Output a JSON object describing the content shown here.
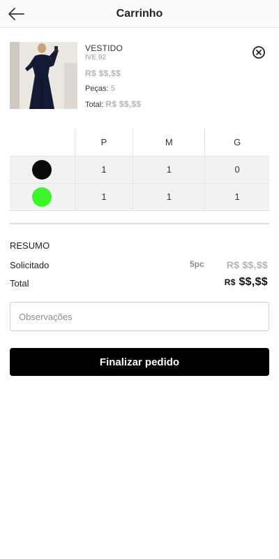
{
  "header": {
    "title": "Carrinho"
  },
  "product": {
    "name": "VESTIDO",
    "code": "IVE 92",
    "price": "R$ $$,$$",
    "pieces_label": "Peças:",
    "pieces_value": "5",
    "total_label": "Total:",
    "total_value": "R$ $$,$$"
  },
  "grid": {
    "sizes": [
      "P",
      "M",
      "G"
    ],
    "rows": [
      {
        "color": "#0a0a0a",
        "qty": [
          "1",
          "1",
          "0"
        ]
      },
      {
        "color": "#3cf52a",
        "qty": [
          "1",
          "1",
          "1"
        ]
      }
    ]
  },
  "summary": {
    "title": "RESUMO",
    "requested_label": "Solicitado",
    "requested_qty": "5pc",
    "requested_value": "R$ $$,$$",
    "total_label": "Total",
    "total_currency": "R$",
    "total_amount": "$$,$$"
  },
  "observations": {
    "placeholder": "Observações",
    "value": ""
  },
  "actions": {
    "finalize_label": "Finalizar pedido"
  },
  "icons": {
    "back": "arrow-left-icon",
    "remove": "close-circle-icon"
  }
}
